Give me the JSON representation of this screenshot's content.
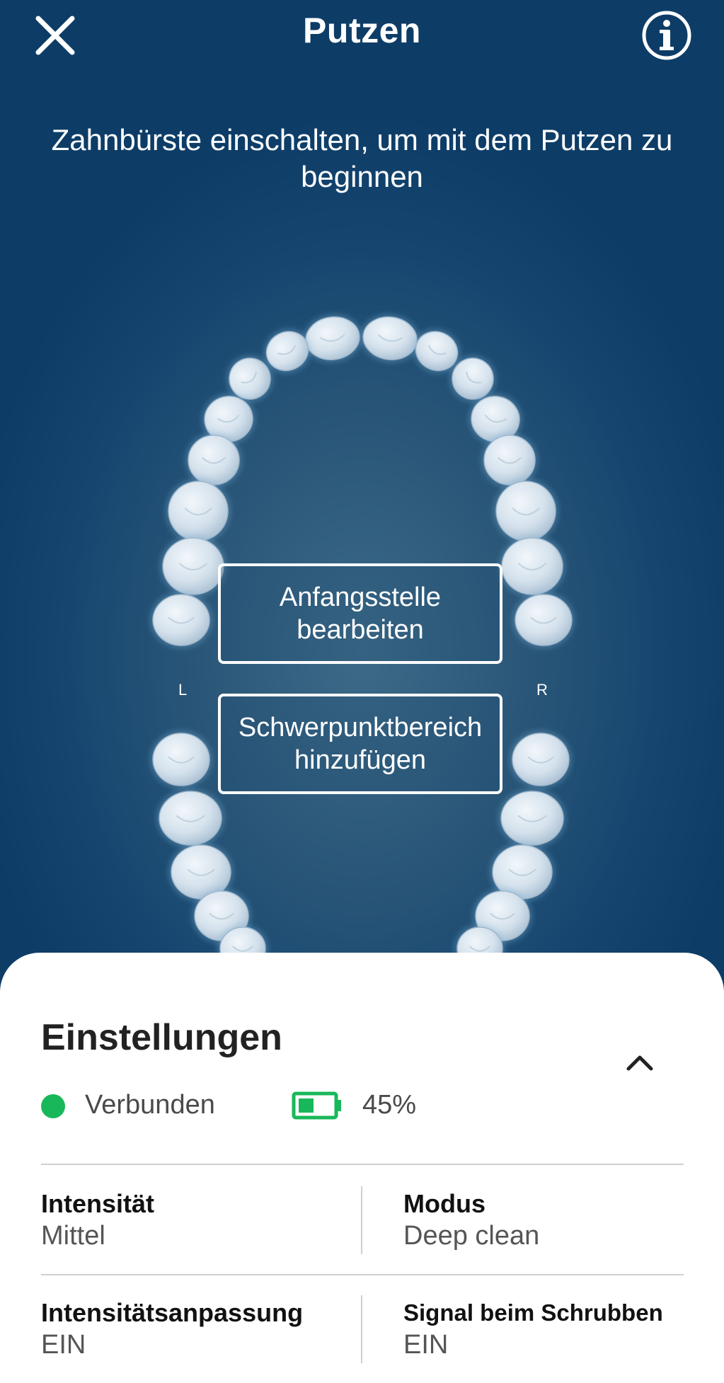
{
  "header": {
    "title": "Putzen",
    "close_icon": "close-icon",
    "info_icon": "info-icon"
  },
  "instruction": "Zahnbürste einschalten, um mit dem Putzen zu beginnen",
  "mouth_map": {
    "left_label": "L",
    "right_label": "R",
    "edit_start_button": "Anfangsstelle bearbeiten",
    "add_focus_button": "Schwerpunktbereich hinzufügen"
  },
  "settings": {
    "title": "Einstellungen",
    "collapse_icon": "chevron-up-icon",
    "connection_status": "Verbunden",
    "battery_percent": "45%",
    "battery_level": 0.45,
    "items": [
      {
        "label": "Intensität",
        "value": "Mittel"
      },
      {
        "label": "Modus",
        "value": "Deep clean"
      },
      {
        "label": "Intensitätsanpassung",
        "value": "EIN"
      },
      {
        "label": "Signal beim Schrubben",
        "value": "EIN"
      }
    ]
  },
  "colors": {
    "background": "#0d3d67",
    "connected_dot": "#18b85a",
    "battery": "#18b85a",
    "sheet": "#ffffff"
  }
}
